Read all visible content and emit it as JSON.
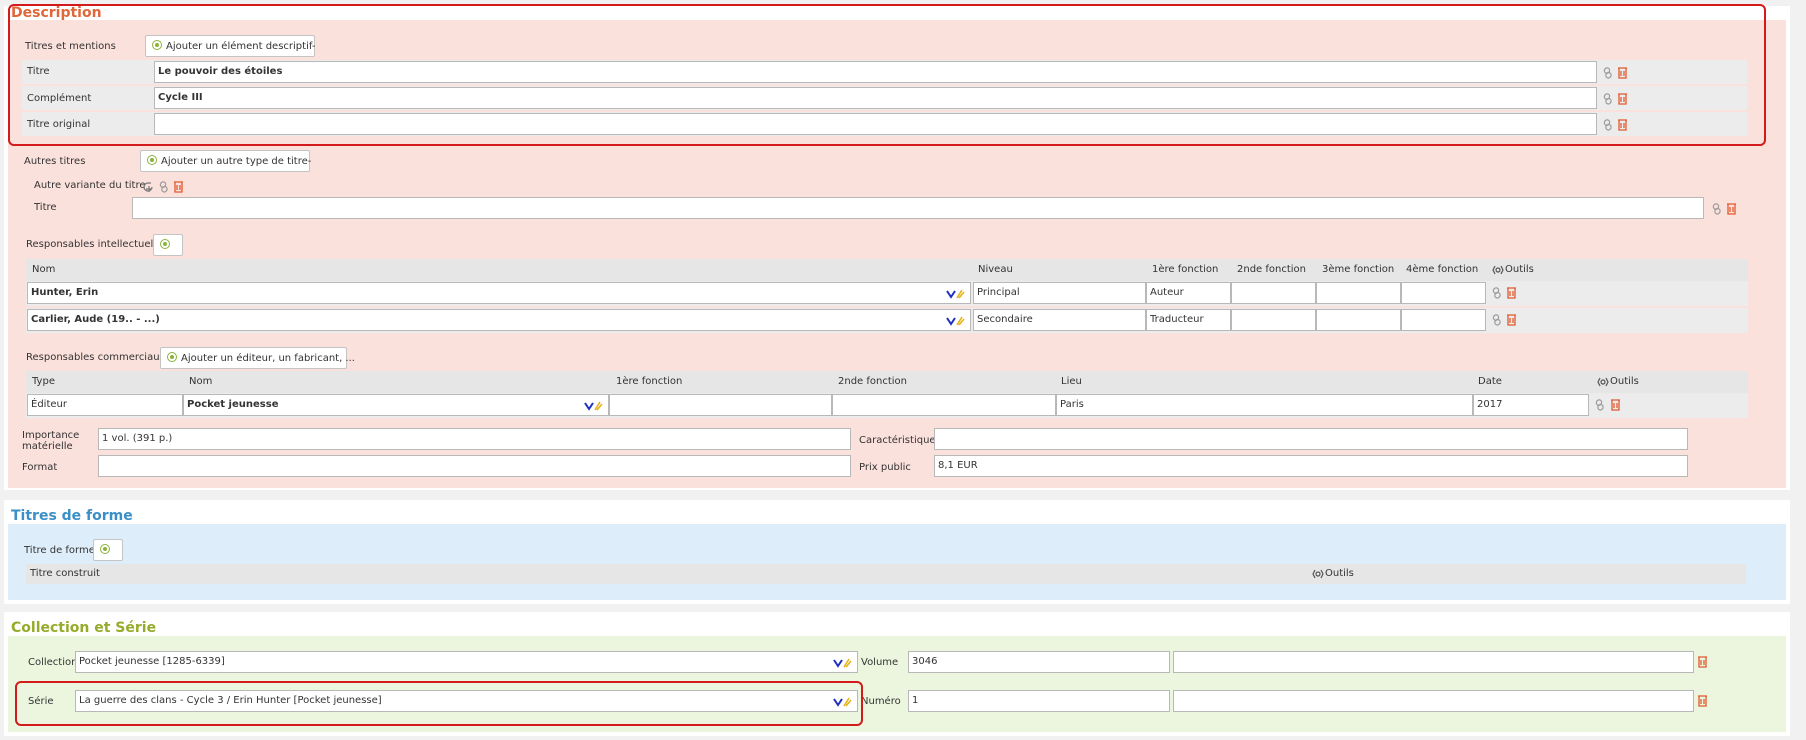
{
  "description": {
    "title": "Description",
    "titres_mentions": {
      "label": "Titres et mentions",
      "button": "Ajouter un élément descriptif-"
    },
    "rows": [
      {
        "label": "Titre",
        "value": "Le pouvoir des étoiles"
      },
      {
        "label": "Complément",
        "value": "Cycle III"
      },
      {
        "label": "Titre original",
        "value": ""
      }
    ],
    "autres_titres": {
      "label": "Autres titres",
      "button": "Ajouter un autre type de titre-",
      "variante": "Autre variante du titre",
      "titre_label": "Titre",
      "titre_value": ""
    },
    "resp_intel": {
      "label": "Responsables intellectuels",
      "headers": [
        "Nom",
        "Niveau",
        "1ère fonction",
        "2nde fonction",
        "3ème fonction",
        "4ème fonction",
        "Outils"
      ],
      "rows": [
        {
          "nom": "Hunter, Erin",
          "niveau": "Principal",
          "f1": "Auteur",
          "f2": "",
          "f3": "",
          "f4": ""
        },
        {
          "nom": "Carlier, Aude (19.. - ...)",
          "niveau": "Secondaire",
          "f1": "Traducteur",
          "f2": "",
          "f3": "",
          "f4": ""
        }
      ]
    },
    "resp_comm": {
      "label": "Responsables commerciaux",
      "button": "Ajouter un éditeur, un fabricant, ...",
      "headers": [
        "Type",
        "Nom",
        "1ère fonction",
        "2nde fonction",
        "Lieu",
        "Date",
        "Outils"
      ],
      "rows": [
        {
          "type": "Éditeur",
          "nom": "Pocket jeunesse",
          "f1": "",
          "f2": "",
          "lieu": "Paris",
          "date": "2017"
        }
      ]
    },
    "importance": {
      "label": "Importance matérielle",
      "value": "1 vol. (391 p.)"
    },
    "caracteristiques": {
      "label": "Caractéristiques",
      "value": ""
    },
    "format": {
      "label": "Format",
      "value": ""
    },
    "prix": {
      "label": "Prix public",
      "value": "8,1 EUR"
    }
  },
  "titres_forme": {
    "title": "Titres de forme",
    "label": "Titre de forme",
    "header_titre": "Titre construit",
    "header_outils": "Outils"
  },
  "collection_serie": {
    "title": "Collection et Série",
    "collection": {
      "label": "Collection",
      "value": "Pocket jeunesse [1285-6339]"
    },
    "volume": {
      "label": "Volume",
      "value": "3046",
      "extra": ""
    },
    "serie": {
      "label": "Série",
      "value": "La guerre des clans - Cycle 3 / Erin Hunter [Pocket jeunesse]"
    },
    "numero": {
      "label": "Numéro",
      "value": "1",
      "extra": ""
    }
  },
  "colors": {
    "description_title": "#e0673a",
    "description_bg": "#fbe1dc",
    "forme_title": "#3b8fc7",
    "forme_bg": "#ddeefa",
    "coll_title": "#97ab2b",
    "coll_bg": "#ecf6de",
    "highlight": "#d31b1b"
  }
}
